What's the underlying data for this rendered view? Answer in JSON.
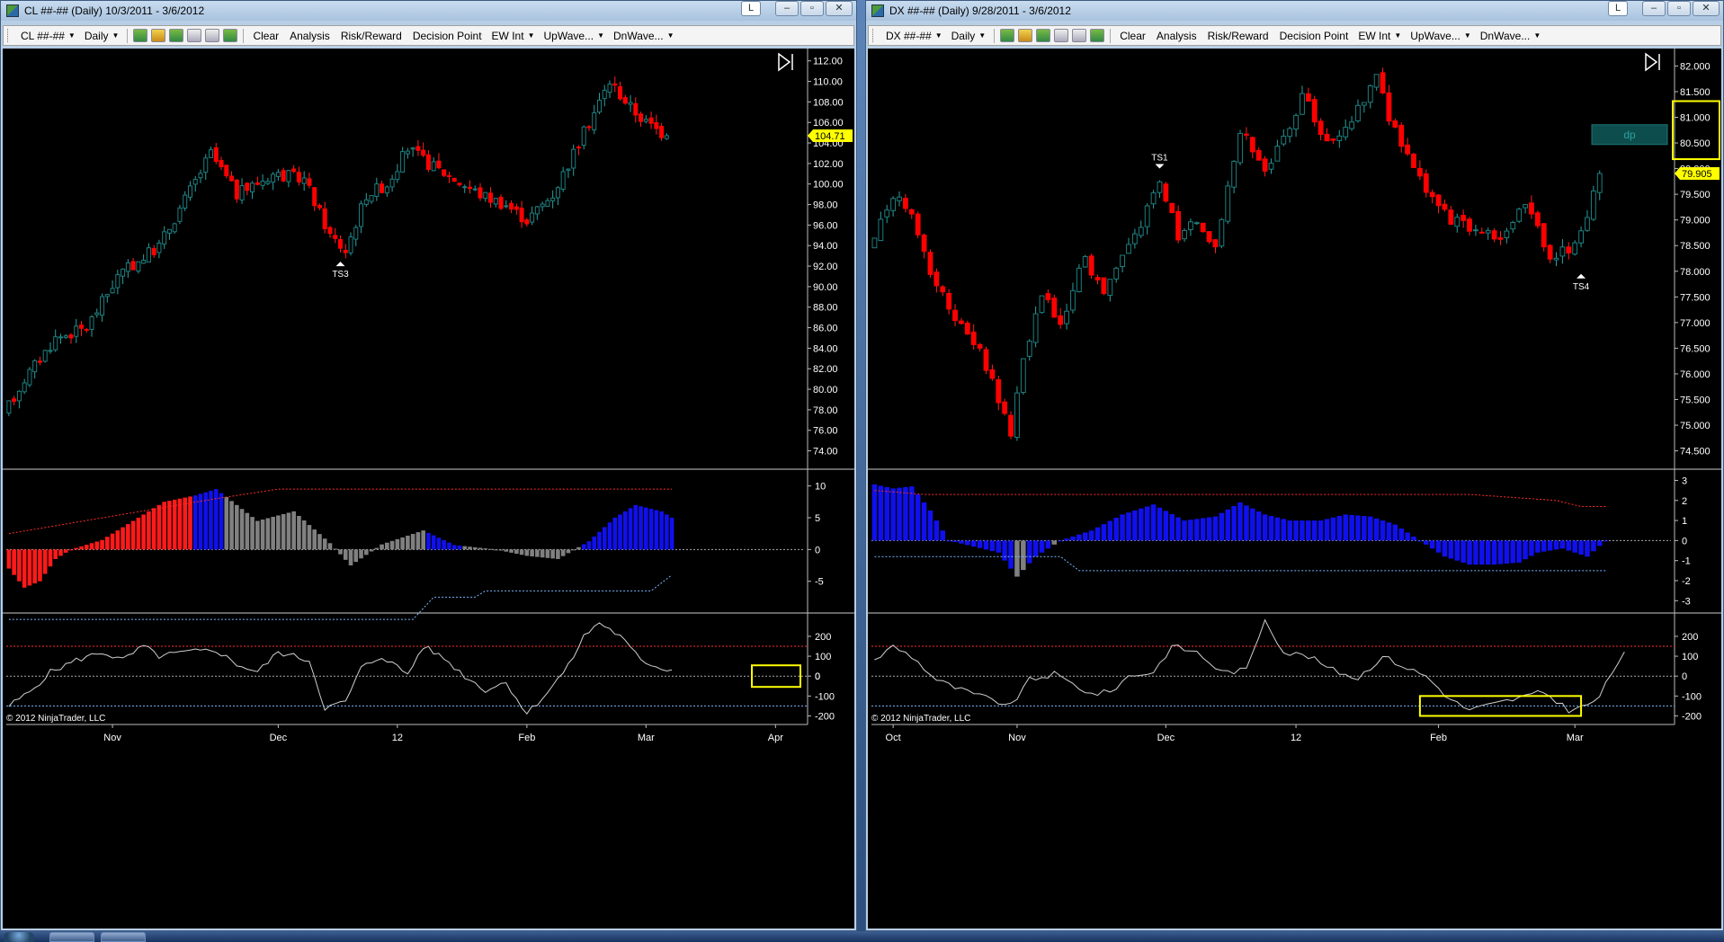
{
  "windows": [
    {
      "id": "cl",
      "title": "CL ##-## (Daily)  10/3/2011 - 3/6/2012",
      "toolbar": {
        "instrument": "CL ##-##",
        "interval": "Daily",
        "clear": "Clear",
        "analysis": "Analysis",
        "risk_reward": "Risk/Reward",
        "decision_point": "Decision Point",
        "ew_int": "EW Int",
        "upwave": "UpWave...",
        "dnwave": "DnWave..."
      },
      "chart_data": {
        "type": "candlestick",
        "price_axis": {
          "min": 73,
          "max": 112.5,
          "ticks": [
            "112.00",
            "110.00",
            "108.00",
            "106.00",
            "104.00",
            "102.00",
            "100.00",
            "98.00",
            "96.00",
            "94.00",
            "92.00",
            "90.00",
            "88.00",
            "86.00",
            "84.00",
            "82.00",
            "80.00",
            "78.00",
            "76.00",
            "74.00"
          ]
        },
        "last_price": "104.71",
        "last_price_value": 104.71,
        "date_labels": [
          "Nov",
          "Dec",
          "12",
          "Feb",
          "Mar",
          "Apr"
        ],
        "date_label_bars": [
          20,
          52,
          75,
          100,
          123,
          148
        ],
        "total_bars": 154,
        "bar_count": 128,
        "price_start": 77.5,
        "price_end": 104.71,
        "price_path": [
          [
            0,
            77.5
          ],
          [
            4,
            81
          ],
          [
            10,
            85
          ],
          [
            16,
            86
          ],
          [
            22,
            91
          ],
          [
            30,
            94
          ],
          [
            40,
            103
          ],
          [
            45,
            99
          ],
          [
            52,
            101
          ],
          [
            58,
            100.5
          ],
          [
            63,
            95
          ],
          [
            66,
            93.5
          ],
          [
            70,
            99
          ],
          [
            74,
            100
          ],
          [
            78,
            103.5
          ],
          [
            82,
            102
          ],
          [
            87,
            100.5
          ],
          [
            92,
            99
          ],
          [
            97,
            98
          ],
          [
            101,
            96.5
          ],
          [
            106,
            99
          ],
          [
            110,
            103
          ],
          [
            114,
            107
          ],
          [
            117,
            110
          ],
          [
            121,
            107.5
          ],
          [
            124,
            106
          ],
          [
            128,
            104.71
          ]
        ],
        "signals": [
          {
            "label": "TS3",
            "bar": 64,
            "price": 92.7,
            "dir": "up"
          }
        ],
        "osc1": {
          "ymin": -9,
          "ymax": 11.5,
          "ticks": [
            "10",
            "5",
            "0",
            "-5"
          ],
          "path": [
            [
              0,
              -3
            ],
            [
              3,
              -6
            ],
            [
              6,
              -5
            ],
            [
              9,
              -1.5
            ],
            [
              12,
              0
            ],
            [
              18,
              1.5
            ],
            [
              24,
              4.5
            ],
            [
              30,
              7.5
            ],
            [
              36,
              8.5
            ],
            [
              40,
              9.5
            ],
            [
              44,
              7
            ],
            [
              48,
              4.5
            ],
            [
              55,
              6
            ],
            [
              62,
              1
            ],
            [
              66,
              -2.5
            ],
            [
              72,
              0.8
            ],
            [
              80,
              3
            ],
            [
              86,
              0.7
            ],
            [
              94,
              0
            ],
            [
              100,
              -1
            ],
            [
              106,
              -1.5
            ],
            [
              112,
              1.3
            ],
            [
              117,
              5
            ],
            [
              121,
              7
            ],
            [
              126,
              6
            ],
            [
              128,
              5
            ]
          ],
          "colors": [
            {
              "to": 35,
              "color": "red"
            },
            {
              "to": 41,
              "color": "blue"
            },
            {
              "to": 80,
              "color": "gray"
            },
            {
              "to": 87,
              "color": "blue"
            },
            {
              "to": 110,
              "color": "gray"
            },
            {
              "to": 128,
              "color": "blue"
            }
          ],
          "upper_band": [
            [
              0,
              2.5
            ],
            [
              40,
              8
            ],
            [
              52,
              9.5
            ],
            [
              128,
              9.5
            ]
          ],
          "lower_band": [
            [
              0,
              -11
            ],
            [
              78,
              -11
            ],
            [
              82,
              -7.5
            ],
            [
              90,
              -7.5
            ],
            [
              92,
              -6.5
            ],
            [
              124,
              -6.5
            ],
            [
              128,
              -4
            ]
          ],
          "red_line_start": 20
        },
        "osc2": {
          "ymin": -225,
          "ymax": 290,
          "ticks": [
            "200",
            "100",
            "0",
            "-100",
            "-200"
          ],
          "current": "0",
          "upper": 150,
          "lower": -150,
          "path": [
            [
              0,
              -150
            ],
            [
              4,
              -80
            ],
            [
              8,
              20
            ],
            [
              13,
              80
            ],
            [
              18,
              120
            ],
            [
              22,
              80
            ],
            [
              26,
              150
            ],
            [
              29,
              100
            ],
            [
              34,
              120
            ],
            [
              40,
              130
            ],
            [
              44,
              60
            ],
            [
              48,
              20
            ],
            [
              52,
              120
            ],
            [
              58,
              80
            ],
            [
              61,
              -160
            ],
            [
              65,
              -130
            ],
            [
              68,
              40
            ],
            [
              72,
              100
            ],
            [
              77,
              10
            ],
            [
              80,
              150
            ],
            [
              84,
              90
            ],
            [
              88,
              0
            ],
            [
              92,
              -70
            ],
            [
              96,
              -30
            ],
            [
              100,
              -190
            ],
            [
              104,
              -80
            ],
            [
              108,
              50
            ],
            [
              111,
              200
            ],
            [
              114,
              270
            ],
            [
              118,
              200
            ],
            [
              122,
              80
            ],
            [
              126,
              40
            ],
            [
              128,
              30
            ]
          ]
        }
      },
      "copyright": "© 2012 NinjaTrader, LLC"
    },
    {
      "id": "dx",
      "title": "DX ##-## (Daily)  9/28/2011 - 3/6/2012",
      "toolbar": {
        "instrument": "DX ##-##",
        "interval": "Daily",
        "clear": "Clear",
        "analysis": "Analysis",
        "risk_reward": "Risk/Reward",
        "decision_point": "Decision Point",
        "ew_int": "EW Int",
        "upwave": "UpWave...",
        "dnwave": "DnWave..."
      },
      "chart_data": {
        "type": "candlestick",
        "price_axis": {
          "min": 74.3,
          "max": 82.2,
          "ticks": [
            "82.000",
            "81.500",
            "81.000",
            "80.500",
            "80.000",
            "79.500",
            "79.000",
            "78.500",
            "78.000",
            "77.500",
            "77.000",
            "76.500",
            "76.000",
            "75.500",
            "75.000",
            "74.500"
          ]
        },
        "last_price": "79.905",
        "last_price_value": 79.905,
        "dp_label": "dp",
        "date_labels": [
          "Oct",
          "Nov",
          "Dec",
          "12",
          "Feb",
          "Mar"
        ],
        "date_label_bars": [
          3,
          23,
          47,
          68,
          91,
          113
        ],
        "total_bars": 129,
        "bar_count": 118,
        "price_path": [
          [
            0,
            78.5
          ],
          [
            4,
            79.5
          ],
          [
            7,
            79
          ],
          [
            10,
            78
          ],
          [
            14,
            77
          ],
          [
            18,
            76.5
          ],
          [
            21,
            75.5
          ],
          [
            23,
            74.9
          ],
          [
            25,
            76.2
          ],
          [
            28,
            77.5
          ],
          [
            31,
            77
          ],
          [
            35,
            78.3
          ],
          [
            38,
            77.5
          ],
          [
            42,
            78.5
          ],
          [
            45,
            79.2
          ],
          [
            47,
            79.8
          ],
          [
            50,
            78.7
          ],
          [
            53,
            79
          ],
          [
            56,
            78.5
          ],
          [
            60,
            80.8
          ],
          [
            64,
            80
          ],
          [
            68,
            80.7
          ],
          [
            70,
            81.5
          ],
          [
            74,
            80.5
          ],
          [
            78,
            81
          ],
          [
            82,
            81.8
          ],
          [
            84,
            81
          ],
          [
            86,
            80.5
          ],
          [
            90,
            79.5
          ],
          [
            94,
            79
          ],
          [
            98,
            78.8
          ],
          [
            102,
            78.7
          ],
          [
            106,
            79.3
          ],
          [
            110,
            78.3
          ],
          [
            113,
            78.4
          ],
          [
            116,
            79
          ],
          [
            118,
            79.905
          ]
        ],
        "signals": [
          {
            "label": "TS1",
            "bar": 46,
            "price": 79.95,
            "dir": "down"
          },
          {
            "label": "TS4",
            "bar": 114,
            "price": 78.0,
            "dir": "up"
          }
        ],
        "osc1": {
          "ymin": -3.3,
          "ymax": 3.2,
          "ticks": [
            "3",
            "2",
            "1",
            "0",
            "-1",
            "-2",
            "-3"
          ],
          "path": [
            [
              0,
              2.8
            ],
            [
              3,
              2.6
            ],
            [
              6,
              2.7
            ],
            [
              9,
              1.5
            ],
            [
              12,
              0
            ],
            [
              16,
              -0.3
            ],
            [
              20,
              -0.6
            ],
            [
              23,
              -1.8
            ],
            [
              26,
              -0.8
            ],
            [
              30,
              0
            ],
            [
              35,
              0.5
            ],
            [
              40,
              1.3
            ],
            [
              45,
              1.8
            ],
            [
              50,
              1
            ],
            [
              55,
              1.2
            ],
            [
              59,
              1.9
            ],
            [
              63,
              1.3
            ],
            [
              67,
              1
            ],
            [
              72,
              1
            ],
            [
              76,
              1.3
            ],
            [
              80,
              1.2
            ],
            [
              84,
              0.8
            ],
            [
              88,
              0
            ],
            [
              92,
              -0.8
            ],
            [
              96,
              -1.2
            ],
            [
              100,
              -1.2
            ],
            [
              104,
              -1.1
            ],
            [
              107,
              -0.6
            ],
            [
              111,
              -0.4
            ],
            [
              115,
              -0.8
            ],
            [
              118,
              0
            ]
          ],
          "colors": [
            {
              "to": 22,
              "color": "blue"
            },
            {
              "to": 24,
              "color": "gray"
            },
            {
              "to": 28,
              "color": "blue"
            },
            {
              "to": 29,
              "color": "gray"
            },
            {
              "to": 30,
              "color": "blue"
            },
            {
              "to": 118,
              "color": "blue"
            }
          ],
          "upper_band": [
            [
              0,
              2.5
            ],
            [
              8,
              2.3
            ],
            [
              96,
              2.3
            ],
            [
              110,
              2
            ],
            [
              114,
              1.7
            ],
            [
              118,
              1.7
            ]
          ],
          "lower_band": [
            [
              0,
              -0.8
            ],
            [
              30,
              -0.8
            ],
            [
              33,
              -1.5
            ],
            [
              118,
              -1.5
            ]
          ],
          "red_line_start": 8
        },
        "osc2": {
          "ymin": -225,
          "ymax": 290,
          "ticks": [
            "200",
            "100",
            "0",
            "-100",
            "-200"
          ],
          "upper": 150,
          "lower": -150,
          "path": [
            [
              0,
              80
            ],
            [
              3,
              150
            ],
            [
              6,
              100
            ],
            [
              10,
              -20
            ],
            [
              14,
              -70
            ],
            [
              18,
              -110
            ],
            [
              22,
              -150
            ],
            [
              25,
              -20
            ],
            [
              29,
              10
            ],
            [
              32,
              -40
            ],
            [
              35,
              -90
            ],
            [
              38,
              -80
            ],
            [
              41,
              0
            ],
            [
              45,
              20
            ],
            [
              48,
              150
            ],
            [
              52,
              120
            ],
            [
              56,
              20
            ],
            [
              60,
              30
            ],
            [
              63,
              290
            ],
            [
              66,
              120
            ],
            [
              70,
              100
            ],
            [
              74,
              30
            ],
            [
              78,
              -10
            ],
            [
              82,
              100
            ],
            [
              86,
              40
            ],
            [
              89,
              0
            ],
            [
              93,
              -120
            ],
            [
              96,
              -170
            ],
            [
              100,
              -140
            ],
            [
              104,
              -110
            ],
            [
              108,
              -80
            ],
            [
              112,
              -170
            ],
            [
              115,
              -150
            ],
            [
              117,
              -100
            ],
            [
              121,
              130
            ]
          ]
        }
      },
      "copyright": "© 2012 NinjaTrader, LLC"
    }
  ],
  "title_buttons": {
    "layout": "L",
    "minimize": "–",
    "restore": "▫",
    "close": "✕"
  },
  "colors": {
    "bull": "#1e7e7e",
    "bear": "#ff0000",
    "axis_text": "#ffffff",
    "last_price_bg": "#ffff00",
    "osc_red": "#ff1a1a",
    "osc_blue": "#1010ee",
    "osc_gray": "#808080",
    "band_red": "#ff2a2a",
    "band_blue": "#7ab8ff",
    "osc_line": "#cfcfcf",
    "highlight": "#ffff00"
  },
  "icons": [
    "app-icon",
    "play-end-icon",
    "candle-icon",
    "pencil-icon",
    "draw-icon",
    "zoom-icon",
    "properties-icon",
    "dollar-icon"
  ]
}
